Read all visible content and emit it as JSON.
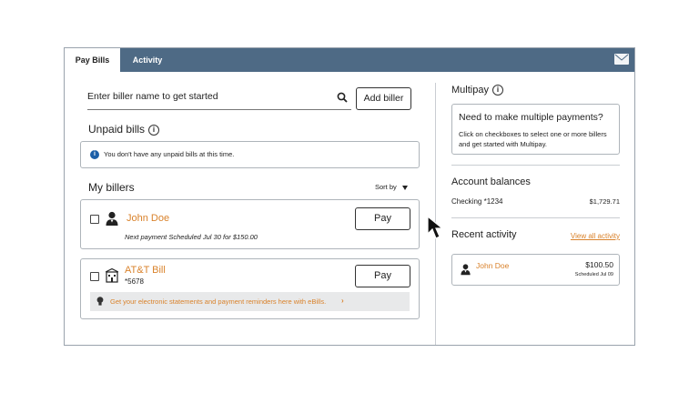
{
  "tabs": {
    "pay_bills": "Pay Bills",
    "activity": "Activity"
  },
  "search": {
    "placeholder": "Enter biller name to get started"
  },
  "add_biller": "Add biller",
  "unpaid": {
    "title": "Unpaid bills",
    "message": "You don't have any unpaid bills at this time."
  },
  "billers": {
    "title": "My billers",
    "sort_by": "Sort by",
    "items": [
      {
        "name": "John Doe",
        "icon": "person-icon",
        "next_payment": "Next payment Scheduled Jul 30 for $150.00",
        "pay_label": "Pay"
      },
      {
        "name": "AT&T Bill",
        "icon": "building-icon",
        "account": "*5678",
        "pay_label": "Pay",
        "ebills_text": "Get your electronic statements and payment reminders here with eBills.",
        "ebills_chevron": "›"
      }
    ]
  },
  "multipay": {
    "title": "Multipay",
    "question": "Need to make multiple payments?",
    "description": "Click on checkboxes to select one or more billers and get started with Multipay."
  },
  "accounts": {
    "title": "Account balances",
    "checking_label": "Checking *1234",
    "checking_balance": "$1,729.71"
  },
  "recent": {
    "title": "Recent activity",
    "view_all": "View all activity",
    "items": [
      {
        "name": "John Doe",
        "amount": "$100.50",
        "date": "Scheduled Jul 09"
      }
    ]
  },
  "colors": {
    "topbar": "#4e6a85",
    "accent": "#d9822b",
    "info_blue": "#1c5fa8"
  }
}
